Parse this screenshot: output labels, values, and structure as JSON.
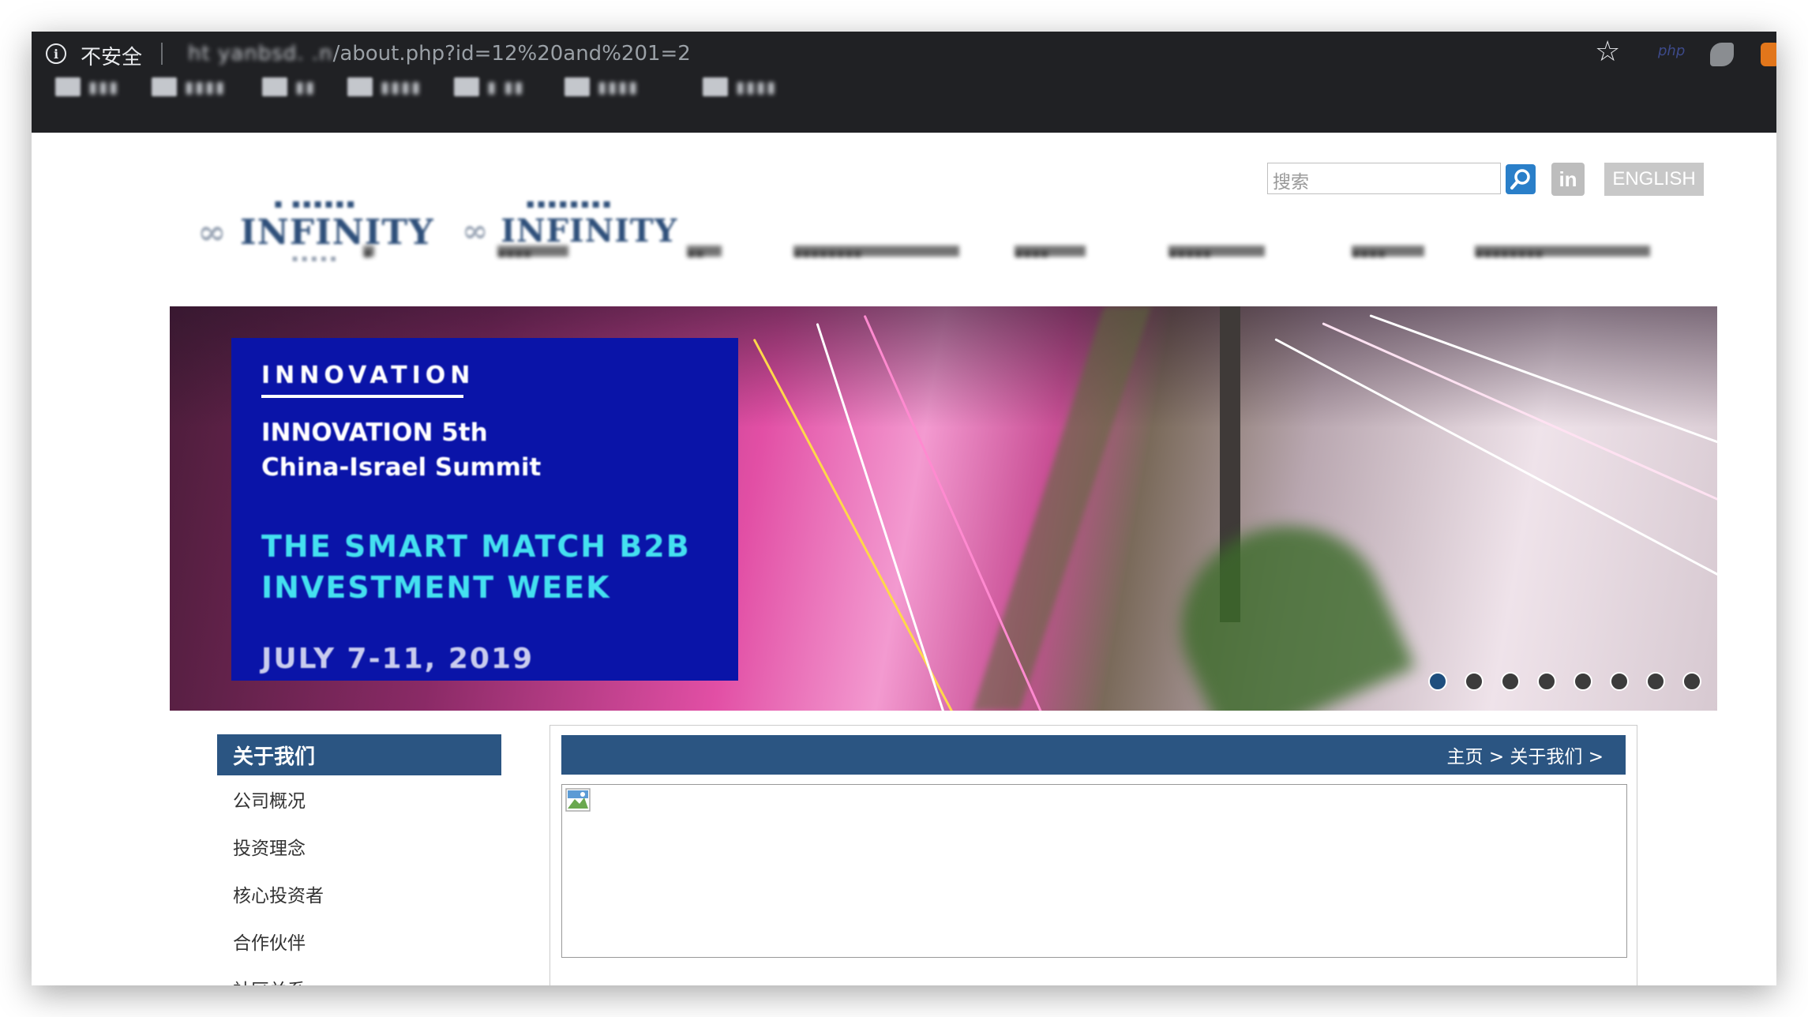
{
  "browser": {
    "security_label": "不安全",
    "url_hidden": "ht  yanbsd.  .n",
    "url_path": "/about.php?id=12%20and%201=2",
    "extension_php": "php",
    "bookmarks": [
      {
        "label": "▮▮▮"
      },
      {
        "label": "▮▮▮▮"
      },
      {
        "label": "▮▮"
      },
      {
        "label": "▮▮▮▮"
      },
      {
        "label": "▮ ▮▮"
      },
      {
        "label": "▮▮▮▮"
      },
      {
        "label": "▮▮▮▮"
      }
    ]
  },
  "header": {
    "logo_left": {
      "top": "▪ ▪▪▪▪▪▪",
      "main": "INFINITY",
      "sub": "▪▪▪▪▪"
    },
    "logo_right": {
      "top": "▪▪▪▪▪▪▪▪",
      "main": "INFINITY"
    },
    "search_placeholder": "搜索",
    "linkedin": "in",
    "english": "ENGLISH"
  },
  "nav": {
    "items": [
      {
        "label": "▪"
      },
      {
        "label": "▪▪▪▪"
      },
      {
        "label": "▪▪"
      },
      {
        "label": "▪▪▪▪▪▪▪▪"
      },
      {
        "label": "▪▪▪▪"
      },
      {
        "label": "▪▪▪▪▪"
      },
      {
        "label": "▪▪▪▪"
      },
      {
        "label": "▪▪▪▪▪▪▪▪"
      }
    ]
  },
  "banner": {
    "tag": "INNOVATION",
    "subtitle_line1": "INNOVATION 5th",
    "subtitle_line2": "China-Israel Summit",
    "headline_line1": "THE SMART MATCH B2B",
    "headline_line2": "INVESTMENT WEEK",
    "date": "JULY 7-11, 2019",
    "dots_total": 8,
    "dots_active_index": 0
  },
  "sidebar": {
    "title": "关于我们",
    "items": [
      {
        "label": "公司概况"
      },
      {
        "label": "投资理念"
      },
      {
        "label": "核心投资者"
      },
      {
        "label": "合作伙伴"
      },
      {
        "label": "社区关系"
      }
    ]
  },
  "content": {
    "breadcrumb": "主页 > 关于我们 >"
  },
  "colors": {
    "chrome_bg": "#202124",
    "brand_blue": "#2b5582",
    "banner_card": "#0a14a8",
    "banner_headline": "#44e0f0"
  }
}
